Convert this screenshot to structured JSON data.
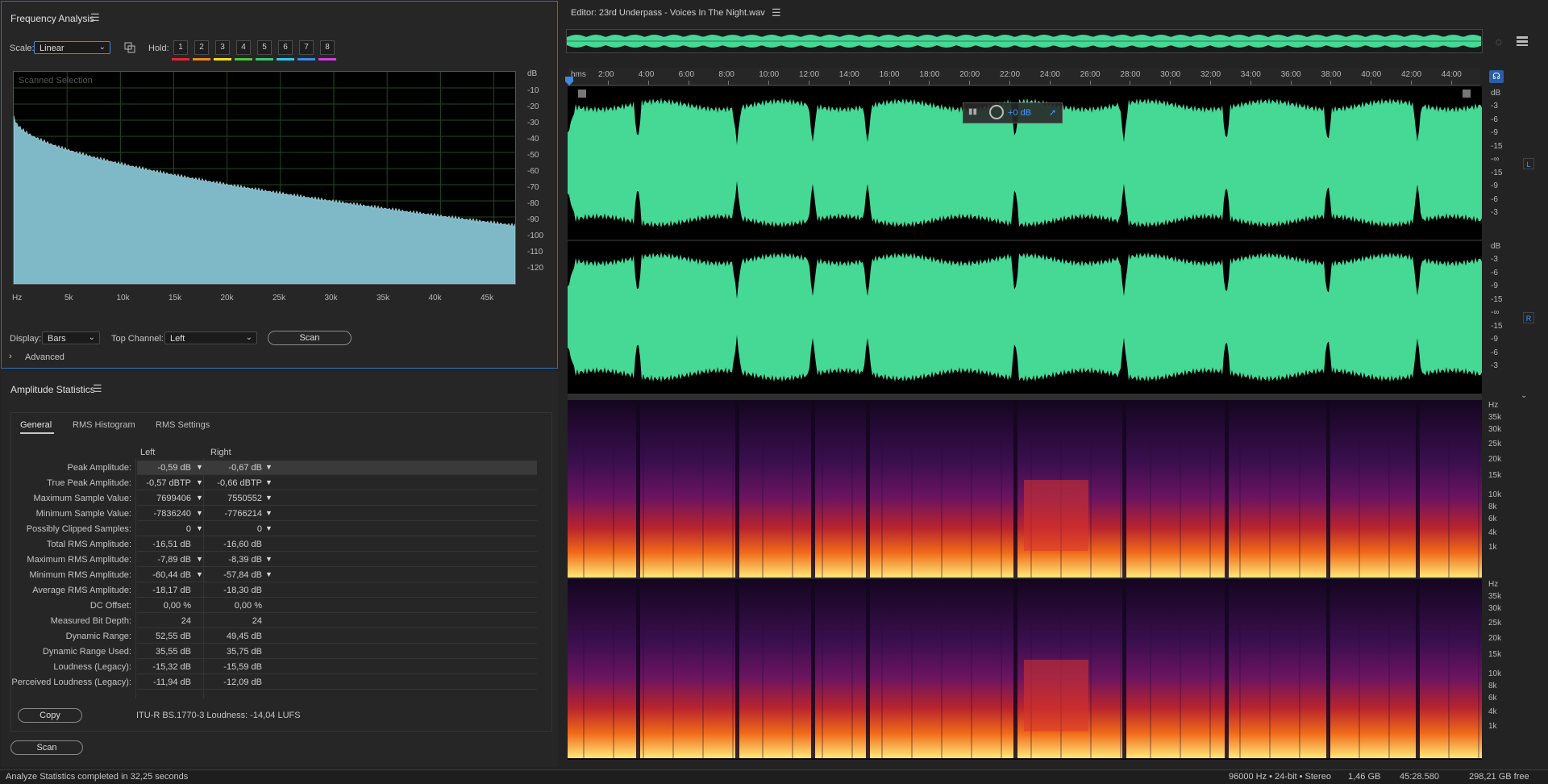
{
  "freq": {
    "title": "Frequency Analysis",
    "scale_label": "Scale:",
    "scale_value": "Linear",
    "hold_label": "Hold:",
    "hold_buttons": [
      "1",
      "2",
      "3",
      "4",
      "5",
      "6",
      "7",
      "8"
    ],
    "hold_colors": [
      "#e3262e",
      "#f08a1d",
      "#f0e21d",
      "#4bc93b",
      "#3bc96a",
      "#31c9e8",
      "#3a8be8",
      "#d93be8"
    ],
    "graph_label": "Scanned Selection",
    "db_label": "dB",
    "db_ticks": [
      "-10",
      "-20",
      "-30",
      "-40",
      "-50",
      "-60",
      "-70",
      "-80",
      "-90",
      "-100",
      "-110",
      "-120"
    ],
    "hz_label": "Hz",
    "hz_ticks": [
      "5k",
      "10k",
      "15k",
      "20k",
      "25k",
      "30k",
      "35k",
      "40k",
      "45k"
    ],
    "display_label": "Display:",
    "display_value": "Bars",
    "top_channel_label": "Top Channel:",
    "top_channel_value": "Left",
    "scan_label": "Scan",
    "advanced_label": "Advanced"
  },
  "amp": {
    "title": "Amplitude Statistics",
    "tabs": [
      "General",
      "RMS Histogram",
      "RMS Settings"
    ],
    "col_left": "Left",
    "col_right": "Right",
    "rows": [
      {
        "label": "Peak Amplitude:",
        "left": "-0,59 dB",
        "right": "-0,67 dB",
        "marker": true
      },
      {
        "label": "True Peak Amplitude:",
        "left": "-0,57 dBTP",
        "right": "-0,66 dBTP",
        "marker": true
      },
      {
        "label": "Maximum Sample Value:",
        "left": "7699406",
        "right": "7550552",
        "marker": true
      },
      {
        "label": "Minimum Sample Value:",
        "left": "-7836240",
        "right": "-7766214",
        "marker": true
      },
      {
        "label": "Possibly Clipped Samples:",
        "left": "0",
        "right": "0",
        "marker": true
      },
      {
        "label": "Total RMS Amplitude:",
        "left": "-16,51 dB",
        "right": "-16,60 dB",
        "marker": false
      },
      {
        "label": "Maximum RMS Amplitude:",
        "left": "-7,89 dB",
        "right": "-8,39 dB",
        "marker": true
      },
      {
        "label": "Minimum RMS Amplitude:",
        "left": "-60,44 dB",
        "right": "-57,84 dB",
        "marker": true
      },
      {
        "label": "Average RMS Amplitude:",
        "left": "-18,17 dB",
        "right": "-18,30 dB",
        "marker": false
      },
      {
        "label": "DC Offset:",
        "left": "0,00 %",
        "right": "0,00 %",
        "marker": false
      },
      {
        "label": "Measured Bit Depth:",
        "left": "24",
        "right": "24",
        "marker": false
      },
      {
        "label": "Dynamic Range:",
        "left": "52,55 dB",
        "right": "49,45 dB",
        "marker": false
      },
      {
        "label": "Dynamic Range Used:",
        "left": "35,55 dB",
        "right": "35,75 dB",
        "marker": false
      },
      {
        "label": "Loudness (Legacy):",
        "left": "-15,32 dB",
        "right": "-15,59 dB",
        "marker": false
      },
      {
        "label": "Perceived Loudness (Legacy):",
        "left": "-11,94 dB",
        "right": "-12,09 dB",
        "marker": false
      }
    ],
    "copy_label": "Copy",
    "loudness_text": "ITU-R BS.1770-3 Loudness: -14,04 LUFS",
    "scan_label": "Scan"
  },
  "editor": {
    "title": "Editor: 23rd Underpass - Voices In The Night.wav",
    "time_unit": "hms",
    "time_ticks": [
      "2:00",
      "4:00",
      "6:00",
      "8:00",
      "10:00",
      "12:00",
      "14:00",
      "16:00",
      "18:00",
      "20:00",
      "22:00",
      "24:00",
      "26:00",
      "28:00",
      "30:00",
      "32:00",
      "34:00",
      "36:00",
      "38:00",
      "40:00",
      "42:00",
      "44:00"
    ],
    "hud_value": "+0 dB",
    "db_label": "dB",
    "wave_scale": [
      "-3",
      "-6",
      "-9",
      "-15",
      "-∞",
      "-15",
      "-9",
      "-6",
      "-3"
    ],
    "channel_left": "L",
    "channel_right": "R",
    "hz_label": "Hz",
    "spec_scale": [
      "35k",
      "30k",
      "25k",
      "20k",
      "15k",
      "10k",
      "8k",
      "6k",
      "4k",
      "1k"
    ],
    "wave_color": "#46d895"
  },
  "status": {
    "message": "Analyze Statistics completed in 32,25 seconds",
    "format": "96000 Hz • 24-bit • Stereo",
    "size": "1,46 GB",
    "duration": "45:28.580",
    "free": "298,21 GB free"
  }
}
